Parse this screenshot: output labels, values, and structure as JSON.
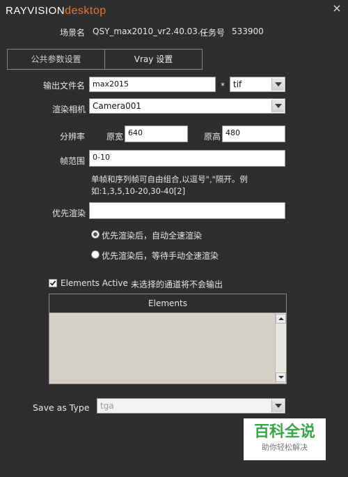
{
  "app": {
    "brand_a": "RAYVISION",
    "brand_b": "desktop",
    "close_glyph": "×"
  },
  "info": {
    "scene_label": "场景名",
    "scene_value": "QSY_max2010_vr2.40.03...",
    "task_label": "任务号",
    "task_value": "533900"
  },
  "tabs": [
    {
      "label": "公共参数设置"
    },
    {
      "label": "Vray 设置"
    }
  ],
  "output": {
    "label": "输出文件名",
    "value": "max2015",
    "star": "*",
    "ext": "tif"
  },
  "camera": {
    "label": "渲染相机",
    "value": "Camera001"
  },
  "resolution": {
    "label": "分辨率",
    "width_label": "原宽",
    "width_value": "640",
    "height_label": "原高",
    "height_value": "480"
  },
  "frames": {
    "label": "帧范围",
    "value": "0-10",
    "hint_line1": "单帧和序列帧可自由组合,以逗号\",\"隔开。例",
    "hint_line2": "如:1,3,5,10-20,30-40[2]"
  },
  "priority": {
    "label": "优先渲染",
    "value": "",
    "option1": "优先渲染后，自动全速渲染",
    "option2": "优先渲染后，等待手动全速渲染"
  },
  "elements": {
    "checkbox_label": "Elements Active",
    "note": "未选择的通道将不会输出",
    "header": "Elements"
  },
  "save": {
    "label": "Save as Type",
    "value": "tga"
  },
  "watermark": {
    "title": "百科全说",
    "subtitle": "助你轻松解决"
  },
  "colors": {
    "brand_orange": "#e8742a",
    "background": "#2e2e2e",
    "list_bg": "#d4d0c8",
    "watermark_green": "#3aa64a"
  }
}
